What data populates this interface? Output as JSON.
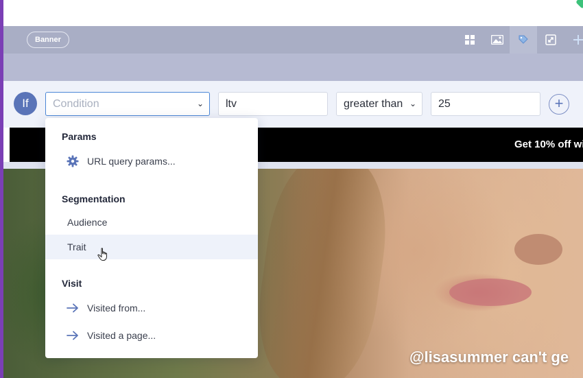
{
  "toolbar": {
    "banner_label": "Banner",
    "icons": [
      "grid-icon",
      "image-icon",
      "tag-icon",
      "resize-icon",
      "move-icon"
    ]
  },
  "condition_row": {
    "if_label": "If",
    "condition_placeholder": "Condition",
    "field_value": "ltv",
    "operator_value": "greater than",
    "compare_value": "25",
    "add_icon": "plus-circle-icon"
  },
  "dropdown": {
    "groups": [
      {
        "header": "Params",
        "items": [
          {
            "label": "URL query params...",
            "icon": "gear-icon"
          }
        ]
      },
      {
        "header": "Segmentation",
        "items": [
          {
            "label": "Audience"
          },
          {
            "label": "Trait",
            "hovered": true
          }
        ]
      },
      {
        "header": "Visit",
        "items": [
          {
            "label": "Visited from...",
            "icon": "arrow-right-icon"
          },
          {
            "label": "Visited a page...",
            "icon": "arrow-right-icon"
          }
        ]
      }
    ]
  },
  "preview": {
    "promo_text": "Get 10% off wi",
    "caption": "@lisasummer can't ge"
  },
  "colors": {
    "accent_blue": "#5a74b8",
    "toolbar_bg": "#a9aec5",
    "purple_accent": "#7b3fb5",
    "hover_bg": "#eef2fa"
  }
}
